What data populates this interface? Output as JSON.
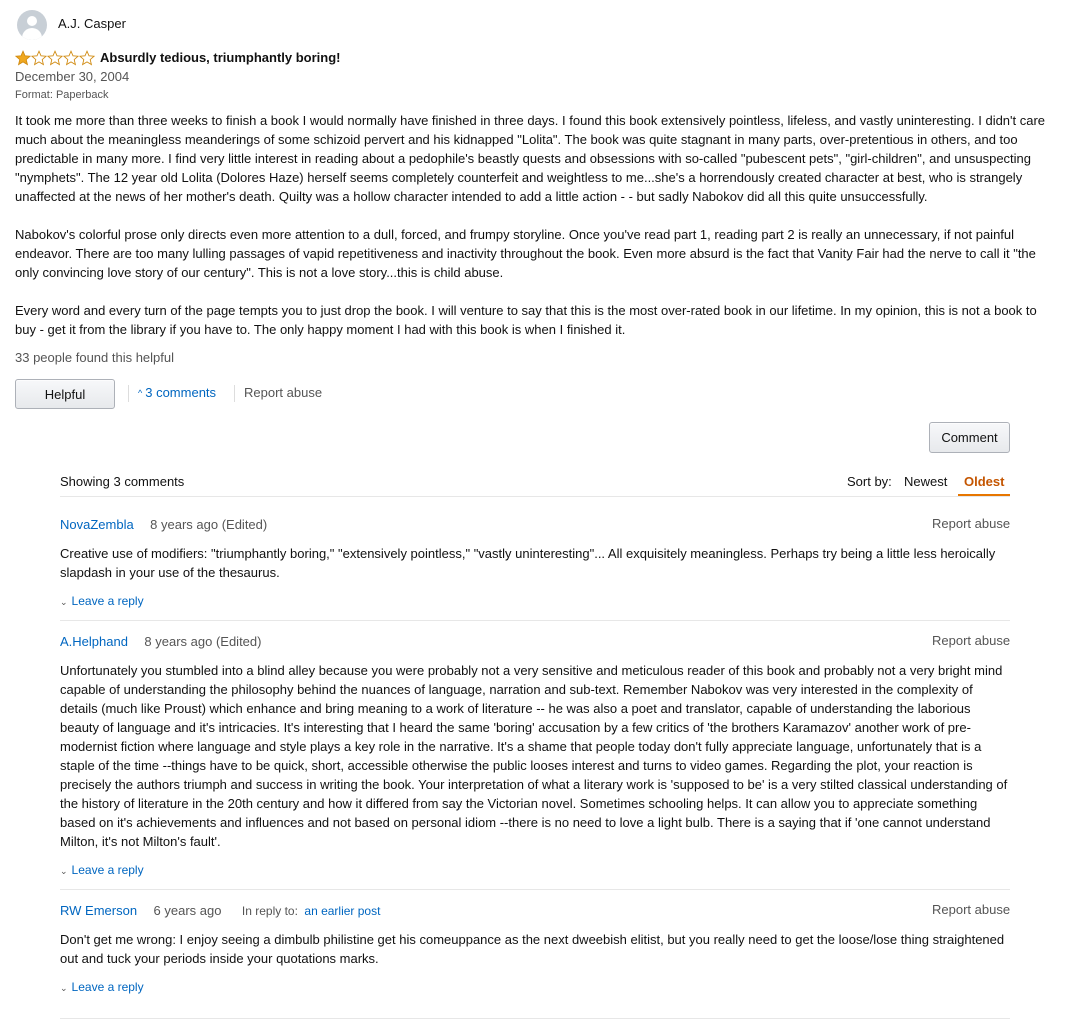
{
  "review": {
    "author": "A.J. Casper",
    "rating": 1,
    "max_rating": 5,
    "title": "Absurdly tedious, triumphantly boring!",
    "date": "December 30, 2004",
    "format": "Format: Paperback",
    "paragraphs": [
      "It took me more than three weeks to finish a book I would normally have finished in three days. I found this book extensively pointless, lifeless, and vastly uninteresting. I didn't care much about the meaningless meanderings of some schizoid pervert and his kidnapped \"Lolita\". The book was quite stagnant in many parts, over-pretentious in others, and too predictable in many more. I find very little interest in reading about a pedophile's beastly quests and obsessions with so-called \"pubescent pets\", \"girl-children\", and unsuspecting \"nymphets\". The 12 year old Lolita (Dolores Haze) herself seems completely counterfeit and weightless to me...she's a horrendously created character at best, who is strangely unaffected at the news of her mother's death. Quilty was a hollow character intended to add a little action - - but sadly Nabokov did all this quite unsuccessfully.",
      "Nabokov's colorful prose only directs even more attention to a dull, forced, and frumpy storyline. Once you've read part 1, reading part 2 is really an unnecessary, if not painful endeavor. There are too many lulling passages of vapid repetitiveness and inactivity throughout the book. Even more absurd is the fact that Vanity Fair had the nerve to call it \"the only convincing love story of our century\". This is not a love story...this is child abuse.",
      "Every word and every turn of the page tempts you to just drop the book. I will venture to say that this is the most over-rated book in our lifetime. In my opinion, this is not a book to buy - get it from the library if you have to. The only happy moment I had with this book is when I finished it."
    ],
    "helpful_count": "33 people found this helpful",
    "helpful_button": "Helpful",
    "comments_link": "3 comments",
    "report_abuse": "Report abuse"
  },
  "comments_section": {
    "comment_button": "Comment",
    "showing": "Showing 3 comments",
    "sort_by": "Sort by:",
    "sort_newest": "Newest",
    "sort_oldest": "Oldest",
    "items": [
      {
        "author": "NovaZembla",
        "age": "8 years ago (Edited)",
        "report": "Report abuse",
        "text": "Creative use of modifiers: \"triumphantly boring,\" \"extensively pointless,\" \"vastly uninteresting\"... All exquisitely meaningless. Perhaps try being a little less heroically slapdash in your use of the thesaurus.",
        "reply": "Leave a reply"
      },
      {
        "author": "A.Helphand",
        "age": "8 years ago (Edited)",
        "report": "Report abuse",
        "text": "Unfortunately you stumbled into a blind alley because you were probably not a very sensitive and meticulous reader of this book and probably not a very bright mind capable of understanding the philosophy behind the nuances of language, narration and sub-text. Remember Nabokov was very interested in the complexity of details (much like Proust) which enhance and bring meaning to a work of literature -- he was also a poet and translator, capable of understanding the laborious beauty of language and it's intricacies. It's interesting that I heard the same 'boring' accusation by a few critics of 'the brothers Karamazov' another work of pre-modernist fiction where language and style plays a key role in the narrative. It's a shame that people today don't fully appreciate language, unfortunately that is a staple of the time --things have to be quick, short, accessible otherwise the public looses interest and turns to video games. Regarding the plot, your reaction is precisely the authors triumph and success in writing the book. Your interpretation of what a literary work is 'supposed to be' is a very stilted classical understanding of the history of literature in the 20th century and how it differed from say the Victorian novel. Sometimes schooling helps. It can allow you to appreciate something based on it's achievements and influences and not based on personal idiom --there is no need to love a light bulb. There is a saying that if 'one cannot understand Milton, it's not Milton's fault'.",
        "reply": "Leave a reply"
      },
      {
        "author": "RW Emerson",
        "age": "6 years ago",
        "in_reply_to": "In reply to:",
        "in_reply_link": "an earlier post",
        "report": "Report abuse",
        "text": "Don't get me wrong: I enjoy seeing a dimbulb philistine get his comeuppance as the next dweebish elitist, but you really need to get the loose/lose thing straightened out and tuck your periods inside your quotations marks.",
        "reply": "Leave a reply"
      }
    ]
  },
  "colors": {
    "link": "#0066c0",
    "star": "#f0a820",
    "sort_active": "#c45500"
  }
}
